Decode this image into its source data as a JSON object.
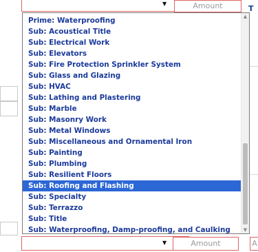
{
  "top_row": {
    "caret": "▼",
    "amount_placeholder": "Amount",
    "side_fragment": "T"
  },
  "dropdown": {
    "options": [
      "Prime: Waterproofing",
      "Sub: Acoustical Title",
      "Sub: Electrical Work",
      "Sub: Elevators",
      "Sub: Fire Protection Sprinkler System",
      "Sub: Glass and Glazing",
      "Sub: HVAC",
      "Sub: Lathing and Plastering",
      "Sub: Marble",
      "Sub: Masonry Work",
      "Sub: Metal Windows",
      "Sub: Miscellaneous and Ornamental Iron",
      "Sub: Painting",
      "Sub: Plumbing",
      "Sub: Resilient Floors",
      "Sub: Roofing and Flashing",
      "Sub: Specialty",
      "Sub: Terrazzo",
      "Sub: Title",
      "Sub: Waterproofing, Damp-proofing, and Caulking"
    ],
    "selected_index": 15,
    "scroll_up": "▲",
    "scroll_down": "▼"
  },
  "bottom_row": {
    "caret": "▼",
    "amount_placeholder": "Amount",
    "side_fragment": "A"
  },
  "colors": {
    "option_text": "#1b3a9a",
    "selected_bg": "#2c67d6",
    "error_border": "#e06262"
  }
}
